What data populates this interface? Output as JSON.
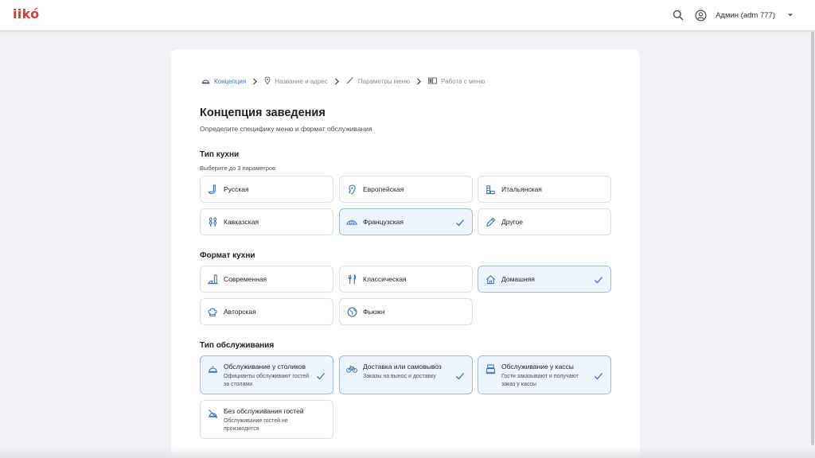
{
  "header": {
    "logo_text": "iikó",
    "user_name": "Админ (adm 777)",
    "icons": [
      "search-icon",
      "user-circle-icon",
      "caret-down-icon"
    ]
  },
  "breadcrumb": [
    {
      "label": "Концепция",
      "icon": "concept-icon",
      "active": true
    },
    {
      "label": "Название и адрес",
      "icon": "location-pin-icon",
      "active": false
    },
    {
      "label": "Параметры меню",
      "icon": "magic-wand-icon",
      "active": false
    },
    {
      "label": "Работа с меню",
      "icon": "book-icon",
      "active": false
    }
  ],
  "page": {
    "title": "Концепция заведения",
    "subtitle": "Определите специфику меню и формат обслуживания"
  },
  "cuisine": {
    "title": "Тип кухни",
    "hint": "Выберите до 3 параметров",
    "options": [
      {
        "label": "Русская",
        "icon": "ladle-icon",
        "selected": false
      },
      {
        "label": "Европейская",
        "icon": "ear-icon",
        "selected": false
      },
      {
        "label": "Итальянская",
        "icon": "tower-icon",
        "selected": false
      },
      {
        "label": "Кавказская",
        "icon": "wheat-icon",
        "selected": false
      },
      {
        "label": "Французская",
        "icon": "bridge-icon",
        "selected": true
      },
      {
        "label": "Другое",
        "icon": "pencil-icon",
        "selected": false
      }
    ]
  },
  "format": {
    "title": "Формат кухни",
    "options": [
      {
        "label": "Современная",
        "icon": "modern-icon",
        "selected": false
      },
      {
        "label": "Классическая",
        "icon": "cutlery-icon",
        "selected": false
      },
      {
        "label": "Домашняя",
        "icon": "home-icon",
        "selected": true
      },
      {
        "label": "Авторская",
        "icon": "chef-hat-icon",
        "selected": false
      },
      {
        "label": "Фьюжн",
        "icon": "globe-icon",
        "selected": false
      }
    ]
  },
  "service": {
    "title": "Тип обслуживания",
    "options": [
      {
        "label": "Обслуживание у столиков",
        "desc": "Официанты обслуживают гостей за столами",
        "icon": "cloche-icon",
        "selected": true
      },
      {
        "label": "Доставка или самовывоз",
        "desc": "Заказы на вынос и доставку",
        "icon": "bicycle-icon",
        "selected": true
      },
      {
        "label": "Обслуживание у кассы",
        "desc": "Гости заказывают и получают заказ у кассы",
        "icon": "cash-register-icon",
        "selected": true
      },
      {
        "label": "Без обслуживания гостей",
        "desc": "Обслуживание гостей не производится",
        "icon": "no-service-icon",
        "selected": false
      }
    ]
  },
  "colors": {
    "accent": "#4472c4",
    "brand": "#e8362d",
    "selected_bg": "#eef4fb",
    "selected_border": "#9fb9df",
    "icon": "#3a6fc0"
  }
}
